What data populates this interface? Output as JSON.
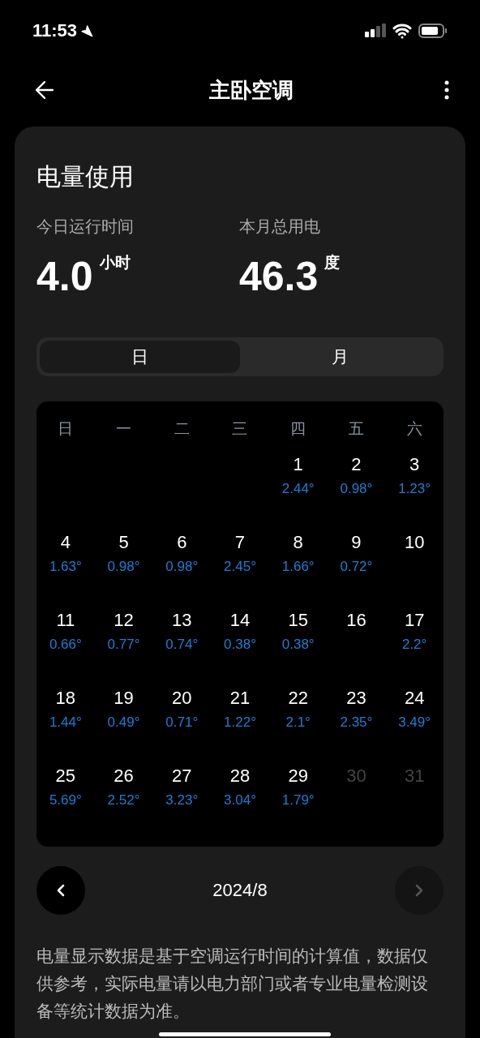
{
  "status_bar": {
    "time": "11:53"
  },
  "header": {
    "title": "主卧空调"
  },
  "card": {
    "title": "电量使用",
    "stats": [
      {
        "label": "今日运行时间",
        "value": "4.0",
        "unit": "小时"
      },
      {
        "label": "本月总用电",
        "value": "46.3",
        "unit": "度"
      }
    ],
    "tabs": [
      {
        "label": "日",
        "selected": true
      },
      {
        "label": "月",
        "selected": false
      }
    ],
    "calendar": {
      "weekdays": [
        "日",
        "一",
        "二",
        "三",
        "四",
        "五",
        "六"
      ],
      "weeks": [
        [
          {
            "day": "1",
            "usage": "2.44°",
            "disabled": false
          },
          {
            "day": "2",
            "usage": "0.98°",
            "disabled": false
          },
          {
            "day": "3",
            "usage": "1.23°",
            "disabled": false
          }
        ],
        [
          {
            "day": "4",
            "usage": "1.63°",
            "disabled": false
          },
          {
            "day": "5",
            "usage": "0.98°",
            "disabled": false
          },
          {
            "day": "6",
            "usage": "0.98°",
            "disabled": false
          },
          {
            "day": "7",
            "usage": "2.45°",
            "disabled": false
          },
          {
            "day": "8",
            "usage": "1.66°",
            "disabled": false
          },
          {
            "day": "9",
            "usage": "0.72°",
            "disabled": false
          },
          {
            "day": "10",
            "disabled": false
          }
        ],
        [
          {
            "day": "11",
            "usage": "0.66°",
            "disabled": false
          },
          {
            "day": "12",
            "usage": "0.77°",
            "disabled": false
          },
          {
            "day": "13",
            "usage": "0.74°",
            "disabled": false
          },
          {
            "day": "14",
            "usage": "0.38°",
            "disabled": false
          },
          {
            "day": "15",
            "usage": "0.38°",
            "disabled": false
          },
          {
            "day": "16",
            "disabled": false
          },
          {
            "day": "17",
            "usage": "2.2°",
            "disabled": false
          }
        ],
        [
          {
            "day": "18",
            "usage": "1.44°",
            "disabled": false
          },
          {
            "day": "19",
            "usage": "0.49°",
            "disabled": false
          },
          {
            "day": "20",
            "usage": "0.71°",
            "disabled": false
          },
          {
            "day": "21",
            "usage": "1.22°",
            "disabled": false
          },
          {
            "day": "22",
            "usage": "2.1°",
            "disabled": false
          },
          {
            "day": "23",
            "usage": "2.35°",
            "disabled": false
          },
          {
            "day": "24",
            "usage": "3.49°",
            "disabled": false
          }
        ],
        [
          {
            "day": "25",
            "usage": "5.69°",
            "disabled": false
          },
          {
            "day": "26",
            "usage": "2.52°",
            "disabled": false
          },
          {
            "day": "27",
            "usage": "3.23°",
            "disabled": false
          },
          {
            "day": "28",
            "usage": "3.04°",
            "disabled": false
          },
          {
            "day": "29",
            "usage": "1.79°",
            "disabled": false
          },
          {
            "day": "30",
            "disabled": true
          },
          {
            "day": "31",
            "disabled": true
          }
        ]
      ]
    },
    "period": {
      "label": "2024/8",
      "prev_disabled": false,
      "next_disabled": true
    },
    "note": "电量显示数据是基于空调运行时间的计算值，数据仅供参考，实际电量请以电力部门或者专业电量检测设备等统计数据为准。"
  }
}
